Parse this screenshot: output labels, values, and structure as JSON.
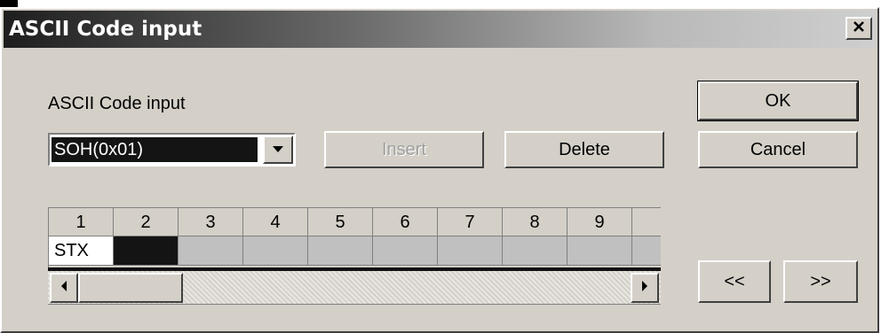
{
  "window": {
    "title": "ASCII Code input",
    "close_label": "✕"
  },
  "form": {
    "section_label": "ASCII Code input",
    "combo_value": "SOH(0x01)"
  },
  "buttons": {
    "ok": "OK",
    "cancel": "Cancel",
    "insert": "Insert",
    "delete": "Delete",
    "prev": "<<",
    "next": ">>"
  },
  "grid": {
    "headers": [
      "1",
      "2",
      "3",
      "4",
      "5",
      "6",
      "7",
      "8",
      "9",
      ""
    ],
    "cells": [
      "STX",
      "",
      "",
      "",
      "",
      "",
      "",
      "",
      "",
      ""
    ],
    "selected_column": 2
  },
  "colors": {
    "dialog_face": "#d4d0c8",
    "selection": "#141414",
    "title_gradient_start": "#1e1e1e"
  },
  "icons": {
    "combo_arrow": "triangle-down",
    "scroll_left": "triangle-left",
    "scroll_right": "triangle-right",
    "close": "x-mark"
  }
}
